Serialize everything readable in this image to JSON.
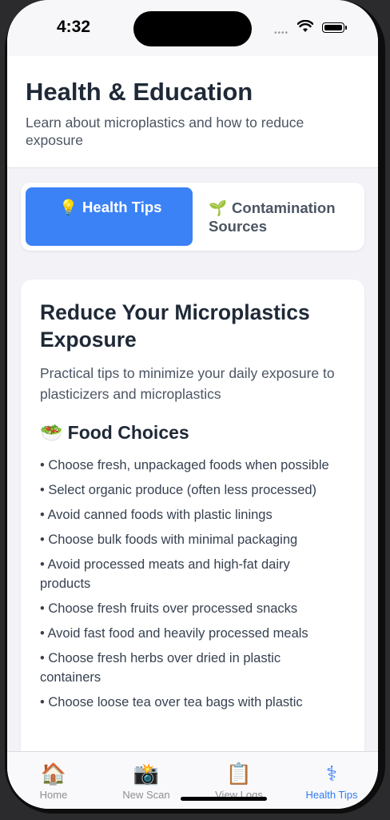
{
  "status": {
    "time": "4:32",
    "signal": "••••"
  },
  "header": {
    "title": "Health & Education",
    "subtitle": "Learn about microplastics and how to reduce exposure"
  },
  "segments": {
    "health": {
      "icon": "💡",
      "label": "Health Tips"
    },
    "contamination": {
      "icon": "🌱",
      "label": "Contamination Sources"
    }
  },
  "card": {
    "title": "Reduce Your Microplastics Exposure",
    "description": "Practical tips to minimize your daily exposure to plasticizers and microplastics",
    "section": {
      "icon": "🥗",
      "title": "Food Choices"
    },
    "tips": [
      "• Choose fresh, unpackaged foods when possible",
      "• Select organic produce (often less processed)",
      "• Avoid canned foods with plastic linings",
      "• Choose bulk foods with minimal packaging",
      "• Avoid processed meats and high-fat dairy products",
      "• Choose fresh fruits over processed snacks",
      "• Avoid fast food and heavily processed meals",
      "• Choose fresh herbs over dried in plastic containers",
      "• Choose loose tea over tea bags with plastic"
    ]
  },
  "tabs": [
    {
      "icon": "🏠",
      "label": "Home"
    },
    {
      "icon": "📸",
      "label": "New Scan"
    },
    {
      "icon": "📋",
      "label": "View Logs"
    },
    {
      "icon": "⚕",
      "label": "Health Tips"
    }
  ],
  "colors": {
    "accent": "#3b82f6",
    "tab_active": "#2f7cf6"
  }
}
